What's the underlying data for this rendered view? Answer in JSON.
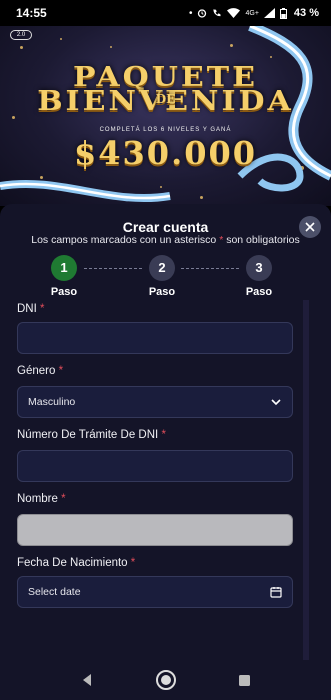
{
  "status_bar": {
    "time": "14:55",
    "network": "4G+",
    "battery": "43 %"
  },
  "banner": {
    "logo": "2.0",
    "line1": "PAQUETE",
    "connector": "DE",
    "line2": "BIENVENIDA",
    "subtitle": "COMPLETÁ LOS 6 NIVELES Y GANÁ",
    "amount": "$430.000",
    "accent_gold": "#f5cf6a"
  },
  "sheet": {
    "title": "Crear cuenta",
    "note_prefix": "Los campos marcados con un asterisco",
    "note_asterisk": "*",
    "note_suffix": "son obligatorios",
    "close_icon": "close-icon"
  },
  "stepper": {
    "steps": [
      {
        "number": "1",
        "label": "Paso",
        "active": true
      },
      {
        "number": "2",
        "label": "Paso",
        "active": false
      },
      {
        "number": "3",
        "label": "Paso",
        "active": false
      }
    ],
    "active_color": "#1f7a32"
  },
  "form": {
    "required_mark": "*",
    "dni": {
      "label": "DNI",
      "value": ""
    },
    "genero": {
      "label": "Género",
      "value": "Masculino"
    },
    "tramite": {
      "label": "Número De Trámite De DNI",
      "value": ""
    },
    "nombre": {
      "label": "Nombre",
      "value": "",
      "disabled": true
    },
    "fecha": {
      "label": "Fecha De Nacimiento",
      "placeholder": "Select date"
    }
  },
  "nav": {
    "back_icon": "back-triangle-icon",
    "home_icon": "home-circle-icon",
    "recents_icon": "recents-square-icon"
  }
}
